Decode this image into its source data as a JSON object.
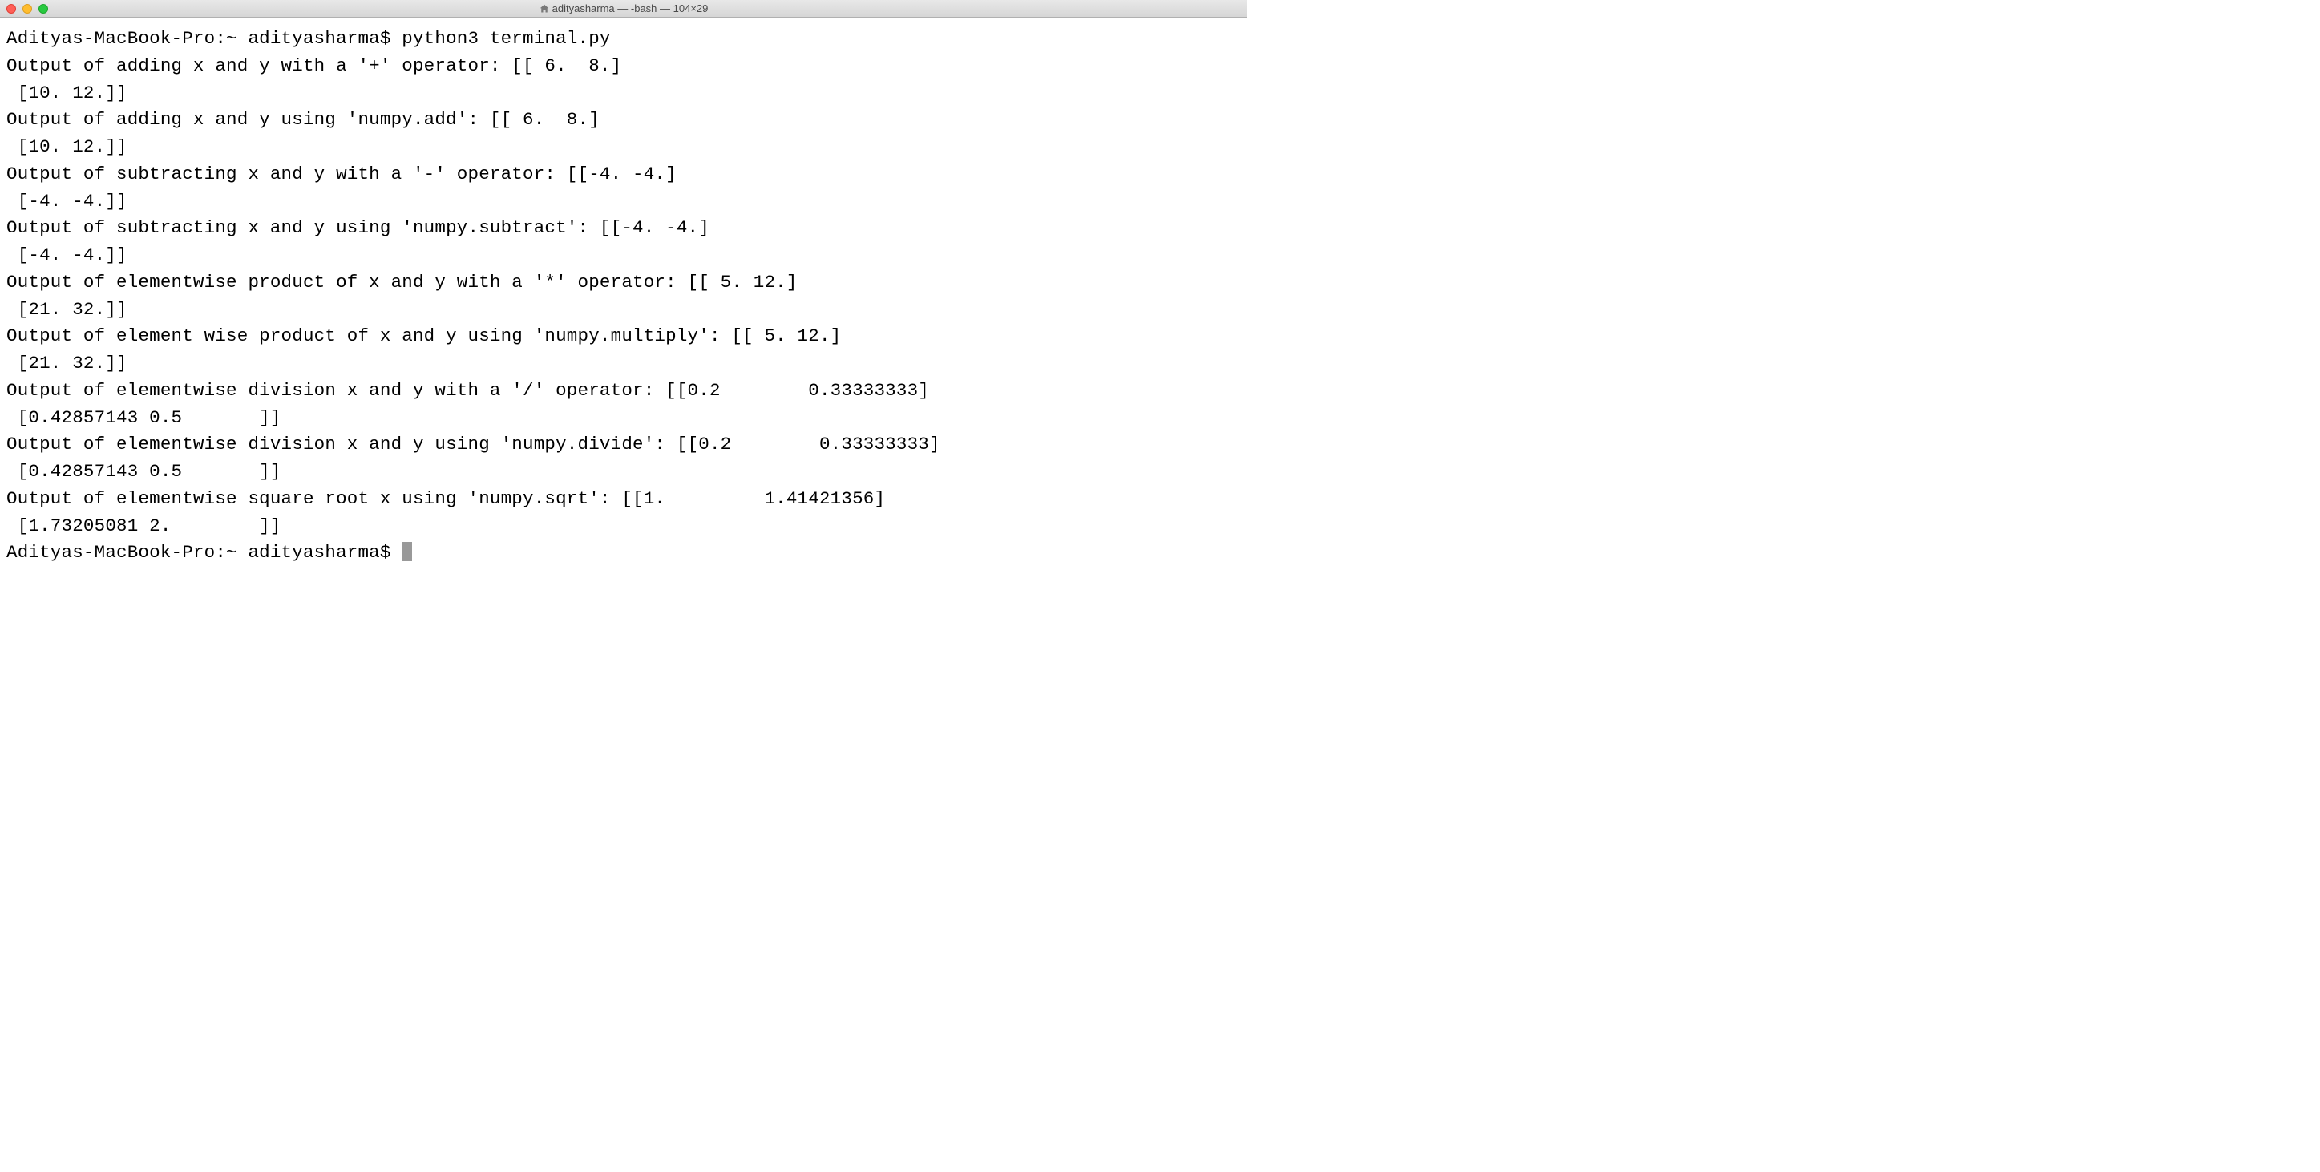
{
  "titlebar": {
    "title": "adityasharma — -bash — 104×29"
  },
  "terminal": {
    "prompt_prefix": "Adityas-MacBook-Pro:~ adityasharma$ ",
    "command": "python3 terminal.py",
    "lines": [
      "Output of adding x and y with a '+' operator: [[ 6.  8.]",
      " [10. 12.]]",
      "Output of adding x and y using 'numpy.add': [[ 6.  8.]",
      " [10. 12.]]",
      "Output of subtracting x and y with a '-' operator: [[-4. -4.]",
      " [-4. -4.]]",
      "Output of subtracting x and y using 'numpy.subtract': [[-4. -4.]",
      " [-4. -4.]]",
      "Output of elementwise product of x and y with a '*' operator: [[ 5. 12.]",
      " [21. 32.]]",
      "Output of element wise product of x and y using 'numpy.multiply': [[ 5. 12.]",
      " [21. 32.]]",
      "Output of elementwise division x and y with a '/' operator: [[0.2        0.33333333]",
      " [0.42857143 0.5       ]]",
      "Output of elementwise division x and y using 'numpy.divide': [[0.2        0.33333333]",
      " [0.42857143 0.5       ]]",
      "Output of elementwise square root x using 'numpy.sqrt': [[1.         1.41421356]",
      " [1.73205081 2.        ]]"
    ],
    "prompt2": "Adityas-MacBook-Pro:~ adityasharma$ "
  }
}
